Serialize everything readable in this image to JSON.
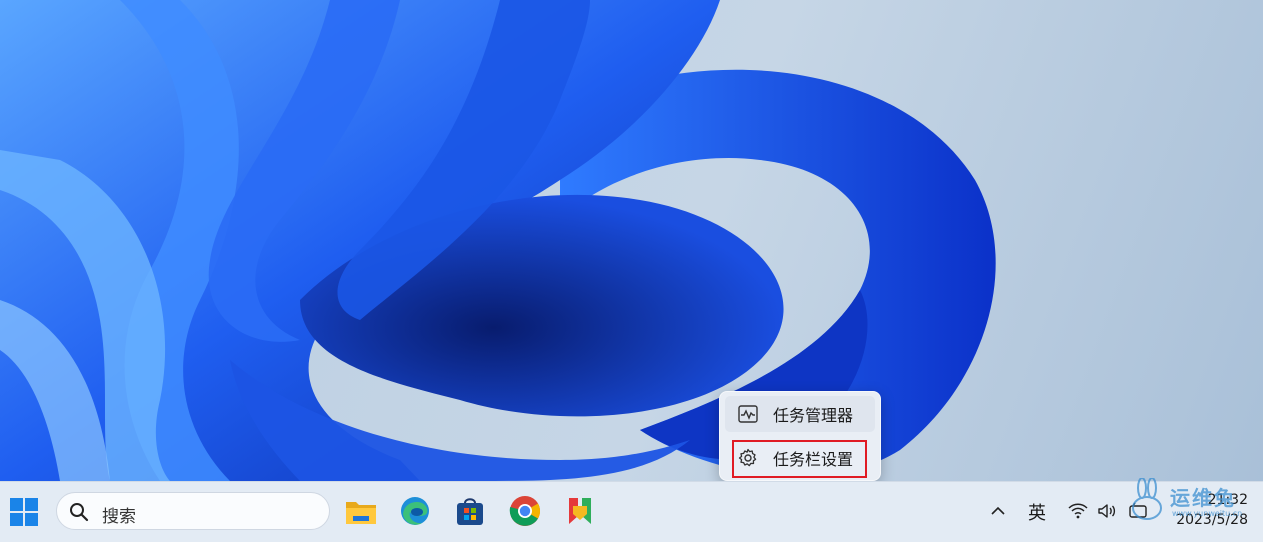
{
  "context_menu": {
    "items": [
      {
        "label": "任务管理器",
        "icon": "task-manager-icon"
      },
      {
        "label": "任务栏设置",
        "icon": "gear-icon",
        "highlighted": true
      }
    ]
  },
  "taskbar": {
    "search_label": "搜索",
    "apps": [
      "file-explorer-icon",
      "edge-icon",
      "microsoft-store-icon",
      "chrome-icon",
      "app-icon"
    ],
    "ime": "英",
    "tray": [
      "show-hidden-icons-chevron",
      "wifi-icon",
      "volume-icon",
      "notification-icon"
    ],
    "time": "21:32",
    "date": "2023/5/28"
  },
  "watermark": {
    "text": "运维兔",
    "url": "www.yunweitu.cn"
  },
  "colors": {
    "highlight": "#e01b24",
    "taskbar_bg": "#e3ebf4",
    "menu_bg": "#e9eef5"
  }
}
